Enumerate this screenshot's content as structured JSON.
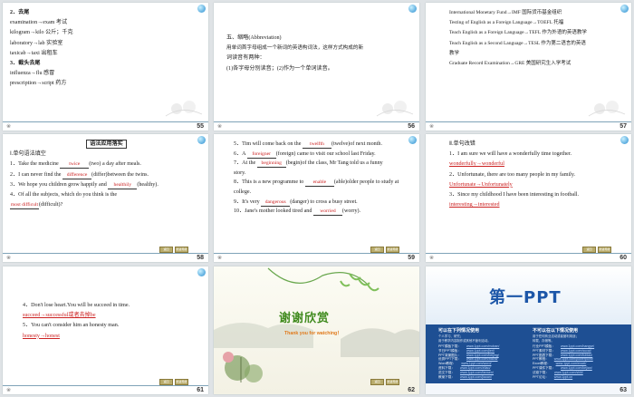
{
  "slides": [
    {
      "num": "55",
      "lines": [
        "2．去尾",
        "examination→exam 考试",
        "kilogram→kilo 公斤；千克",
        "laboratory→lab 实验室",
        "taxicab→taxi 出租车",
        "3．截头去尾",
        "influenza→flu 感冒",
        "prescription→script 药方"
      ]
    },
    {
      "num": "56",
      "lines": [
        "五、缩略(Abbreviation)",
        "用单词首字母组成一个新词的英语构词法，这样方式构成的新",
        "词读音有两种：",
        "(1)各字母分别读音；(2)作为一个单词读音。"
      ]
    },
    {
      "num": "57",
      "lines": [
        "International Monetary Fund→IMF 国际货币基金组织",
        "Testing of English as a Foreign Language→TOEFL 托福",
        "Teach English as a Foreign Language→TEFL 作为外语的英语教学",
        "Teach English as a Second Language→TESL 作为第二语言的英语",
        "教学",
        "Graduate Record Examination→GRE 美国研究生入学考试"
      ]
    },
    {
      "num": "58",
      "title": "语法应用落实",
      "heading": "Ⅰ.单句语法填空",
      "items": [
        {
          "pre": "1．Take the medicine",
          "ans": "twice",
          "post": "(two) a day after meals."
        },
        {
          "pre": "2．I can never find the",
          "ans": "difference",
          "post": "(differ)between the twins."
        },
        {
          "pre": "3．We hope you children grow happily and",
          "ans": "healthily",
          "post": "(healthy)."
        },
        {
          "pre": "4．Of all the subjects, which do you think is the",
          "ans": "",
          "post": ""
        },
        {
          "pre": "",
          "ans": "most difficult",
          "post": "(difficult)?"
        }
      ]
    },
    {
      "num": "59",
      "items": [
        {
          "pre": "5．Tim will come back on the",
          "ans": "twelfth",
          "post": "(twelve)of next month."
        },
        {
          "pre": "6．A",
          "ans": "foreigner",
          "post": "(foreign) came to visit our school last Friday."
        },
        {
          "pre": "7．At the",
          "ans": "beginning",
          "post": "(begin)of the class, Mr Tang told us a funny"
        },
        {
          "pre": "story.",
          "ans": "",
          "post": ""
        },
        {
          "pre": "8．This is a new programme to",
          "ans": "enable",
          "post": "(able)older people to study at"
        },
        {
          "pre": "college.",
          "ans": "",
          "post": ""
        },
        {
          "pre": "9．It's very",
          "ans": "dangerous",
          "post": "(danger) to cross a busy street."
        },
        {
          "pre": "10．Jane's mother looked tired and",
          "ans": "worried",
          "post": "(worry)."
        }
      ]
    },
    {
      "num": "60",
      "heading": "Ⅱ.单句改错",
      "lines": [
        "1．I am sure we will have a wonderfully time together.",
        "wonderfully→wonderful",
        "2．Unfortunate, there are too many people in my family.",
        "Unfortunate→Unfortunately",
        "3．Since my childhood I have been interesting in football.",
        "interesting→interested"
      ]
    },
    {
      "num": "61",
      "lines": [
        "4．Don't lose heart.You will be succeed in time.",
        "succeed→successful或者去掉be",
        "5．You can't consider him an honesty man.",
        "honesty→honest"
      ]
    },
    {
      "num": "62",
      "title": "谢谢欣赏",
      "subtitle": "Thank you for watching！"
    },
    {
      "num": "63",
      "logo": "第一PPT",
      "left_heading": "可以在下列情况使用",
      "left_sub": [
        "个人学习、研究；",
        "用于教学内容制作或其他不营利活动。"
      ],
      "right_heading": "不可以在以下情况使用",
      "right_sub": [
        "用于任何商业活动或者营利用途；",
        "转载、存储等。"
      ],
      "left_links": [
        {
          "label": "PPT模板下载：",
          "url": "www.1ppt.com/moban/"
        },
        {
          "label": "节日PPT模板：",
          "url": "www.1ppt.com/jieri/"
        },
        {
          "label": "PPT背景图片：",
          "url": "www.1ppt.com/beijing/"
        },
        {
          "label": "优秀PPT下载：",
          "url": "www.1ppt.com/xiazai/"
        },
        {
          "label": "Word教程：",
          "url": "www.1ppt.com/word/"
        },
        {
          "label": "资料下载：",
          "url": "www.1ppt.com/ziliao/"
        },
        {
          "label": "范文下载：",
          "url": "www.1ppt.com/fanwen/"
        },
        {
          "label": "教案下载：",
          "url": "www.1ppt.com/jiaoan/"
        }
      ],
      "right_links": [
        {
          "label": "行业PPT模板：",
          "url": "www.1ppt.com/hangye/"
        },
        {
          "label": "PPT素材下载：",
          "url": "www.1ppt.com/sucai/"
        },
        {
          "label": "PPT图表下载：",
          "url": "www.1ppt.com/tubiao/"
        },
        {
          "label": "PPT教程：",
          "url": "www.1ppt.com/powerpoint/"
        },
        {
          "label": "Excel教程：",
          "url": "www.1ppt.com/excel/"
        },
        {
          "label": "PPT课件下载：",
          "url": "www.1ppt.com/kejian/"
        },
        {
          "label": "试卷下载：",
          "url": "www.1ppt.com/shiti/"
        },
        {
          "label": "PPT论坛：",
          "url": "www.1ppt.cn"
        }
      ]
    }
  ],
  "nav": {
    "prev_label": "返回",
    "next_label": "前进导航"
  },
  "colors": {
    "answer": "#c22222",
    "thanks": "#3f8a1d",
    "bg": "#dfe3e6"
  }
}
